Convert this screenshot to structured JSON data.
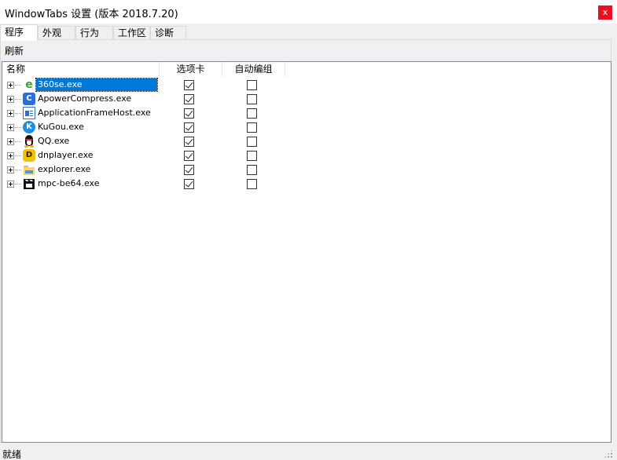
{
  "window": {
    "title": "WindowTabs 设置 (版本 2018.7.20)",
    "close_label": "x"
  },
  "tabs": [
    {
      "label": "程序",
      "active": true
    },
    {
      "label": "外观",
      "active": false
    },
    {
      "label": "行为",
      "active": false
    },
    {
      "label": "工作区",
      "active": false
    },
    {
      "label": "诊断",
      "active": false
    }
  ],
  "toolbar": {
    "refresh_label": "刷新"
  },
  "tree": {
    "columns": [
      "名称",
      "选项卡",
      "自动编组"
    ],
    "rows": [
      {
        "name": "360se.exe",
        "tabs": true,
        "autogroup": false,
        "icon": "360se-icon",
        "selected": true
      },
      {
        "name": "ApowerCompress.exe",
        "tabs": true,
        "autogroup": false,
        "icon": "apowercompress-icon",
        "selected": false
      },
      {
        "name": "ApplicationFrameHost.exe",
        "tabs": true,
        "autogroup": false,
        "icon": "application-frame-icon",
        "selected": false
      },
      {
        "name": "KuGou.exe",
        "tabs": true,
        "autogroup": false,
        "icon": "kugou-icon",
        "selected": false
      },
      {
        "name": "QQ.exe",
        "tabs": true,
        "autogroup": false,
        "icon": "qq-penguin-icon",
        "selected": false
      },
      {
        "name": "dnplayer.exe",
        "tabs": true,
        "autogroup": false,
        "icon": "dnplayer-icon",
        "selected": false
      },
      {
        "name": "explorer.exe",
        "tabs": true,
        "autogroup": false,
        "icon": "folder-icon",
        "selected": false
      },
      {
        "name": "mpc-be64.exe",
        "tabs": true,
        "autogroup": false,
        "icon": "clapperboard-icon",
        "selected": false
      }
    ]
  },
  "statusbar": {
    "text": "就绪"
  },
  "colors": {
    "selection": "#0078d7",
    "close": "#e81123"
  }
}
